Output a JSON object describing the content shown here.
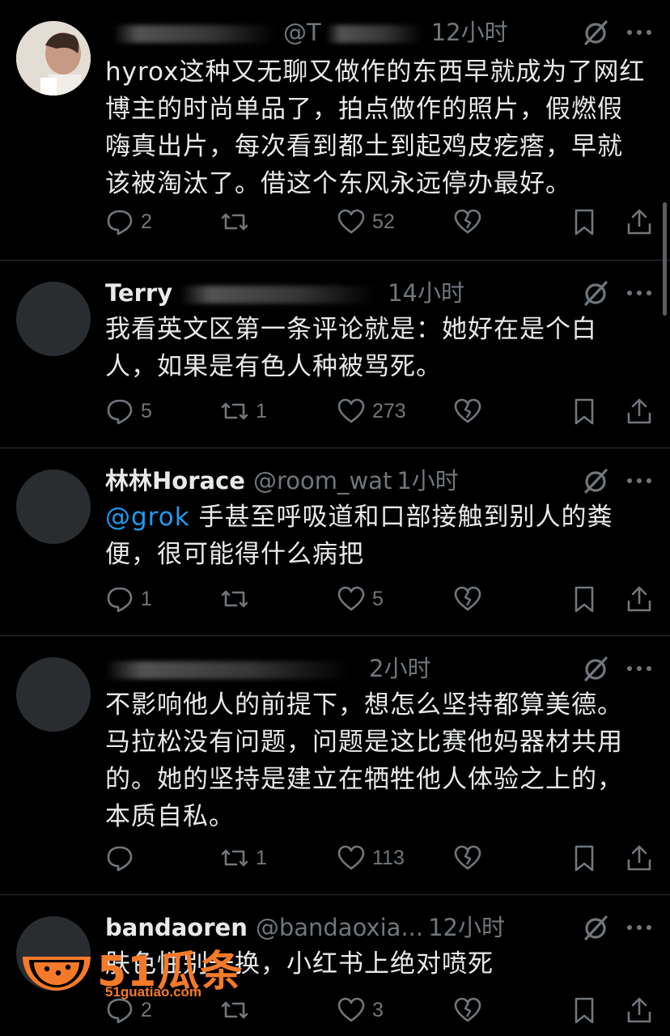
{
  "posts": [
    {
      "name": "",
      "handle": "@T",
      "time": "12小时",
      "text": "hyrox这种又无聊又做作的东西早就成为了网红博主的时尚单品了，拍点做作的照片，假燃假嗨真出片，每次看到都土到起鸡皮疙瘩，早就该被淘汰了。借这个东风永远停办最好。",
      "mention": "",
      "replies": "2",
      "reposts": "",
      "likes": "52"
    },
    {
      "name": "Terry",
      "handle": "",
      "time": "14小时",
      "text": "我看英文区第一条评论就是：她好在是个白人，如果是有色人种被骂死。",
      "mention": "",
      "replies": "5",
      "reposts": "1",
      "likes": "273"
    },
    {
      "name": "林林Horace",
      "handle": "@room_wat",
      "time": "1小时",
      "mention": "@grok",
      "text": " 手甚至呼吸道和口部接触到别人的粪便，很可能得什么病把",
      "replies": "1",
      "reposts": "",
      "likes": "5"
    },
    {
      "name": "",
      "handle": "",
      "time": "2小时",
      "text": "不影响他人的前提下，想怎么坚持都算美德。马拉松没有问题，问题是这比赛他妈器材共用的。她的坚持是建立在牺牲他人体验之上的，本质自私。",
      "mention": "",
      "replies": "",
      "reposts": "1",
      "likes": "113"
    },
    {
      "name": "bandaoren",
      "handle": "@bandaoxia...",
      "time": "12小时",
      "text": "肤色性别一换，小红书上绝对喷死",
      "mention": "",
      "replies": "2",
      "reposts": "",
      "likes": "3"
    }
  ],
  "watermark": {
    "brand": "51瓜条",
    "site": "51guatiao.com"
  },
  "colors": {
    "background": "#000000",
    "text": "#e7e9ea",
    "muted": "#71767b",
    "link": "#1d9bf0",
    "divider": "#2f3336",
    "watermark": "#f47a2a"
  },
  "icons": {
    "reply": "reply-icon",
    "repost": "repost-icon",
    "like": "heart-icon",
    "dislike": "broken-heart-icon",
    "bookmark": "bookmark-icon",
    "share": "share-icon",
    "grok": "grok-icon",
    "more": "more-icon"
  }
}
